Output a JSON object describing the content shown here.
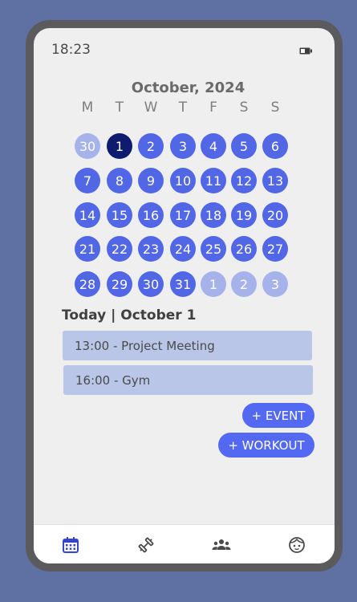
{
  "status": {
    "time": "18:23",
    "battery_icon": "battery-icon"
  },
  "calendar": {
    "title": "October, 2024",
    "weekdays": [
      "M",
      "T",
      "W",
      "T",
      "F",
      "S",
      "S"
    ],
    "selected_day": "1",
    "weeks": [
      [
        {
          "d": "30",
          "muted": true
        },
        {
          "d": "1",
          "selected": true
        },
        {
          "d": "2"
        },
        {
          "d": "3"
        },
        {
          "d": "4"
        },
        {
          "d": "5"
        },
        {
          "d": "6"
        }
      ],
      [
        {
          "d": "7"
        },
        {
          "d": "8"
        },
        {
          "d": "9"
        },
        {
          "d": "10"
        },
        {
          "d": "11"
        },
        {
          "d": "12"
        },
        {
          "d": "13"
        }
      ],
      [
        {
          "d": "14"
        },
        {
          "d": "15"
        },
        {
          "d": "16"
        },
        {
          "d": "17"
        },
        {
          "d": "18"
        },
        {
          "d": "19"
        },
        {
          "d": "20"
        }
      ],
      [
        {
          "d": "21"
        },
        {
          "d": "22"
        },
        {
          "d": "23"
        },
        {
          "d": "24"
        },
        {
          "d": "25"
        },
        {
          "d": "26"
        },
        {
          "d": "27"
        }
      ],
      [
        {
          "d": "28"
        },
        {
          "d": "29"
        },
        {
          "d": "30"
        },
        {
          "d": "31"
        },
        {
          "d": "1",
          "muted": true
        },
        {
          "d": "2",
          "muted": true
        },
        {
          "d": "3",
          "muted": true
        }
      ]
    ]
  },
  "agenda": {
    "heading": "Today | October 1",
    "events": [
      "13:00 - Project Meeting",
      "16:00 - Gym"
    ]
  },
  "actions": {
    "add_event": "+ EVENT",
    "add_workout": "+ WORKOUT"
  },
  "nav": {
    "items": [
      {
        "icon": "calendar-icon",
        "active": true
      },
      {
        "icon": "dumbbell-icon",
        "active": false
      },
      {
        "icon": "group-icon",
        "active": false
      },
      {
        "icon": "face-icon",
        "active": false
      }
    ]
  },
  "colors": {
    "accent": "#5167e6",
    "selected": "#0e1b6e",
    "muted_day": "#a6b2ea",
    "event_bg": "#b9c6e8",
    "nav_active": "#3545c9",
    "nav_inactive": "#4a4a4a"
  }
}
